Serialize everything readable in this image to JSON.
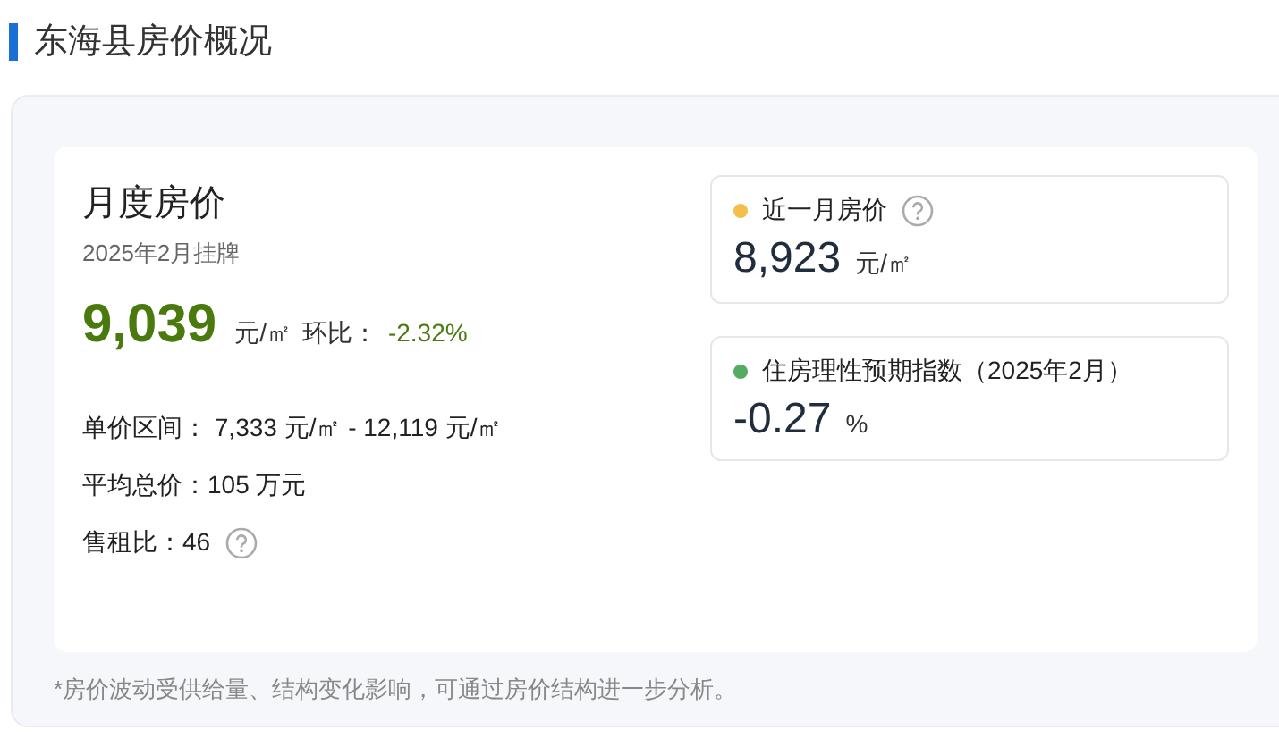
{
  "title": "东海县房价概况",
  "monthly": {
    "title": "月度房价",
    "subtitle": "2025年2月挂牌",
    "price": "9,039",
    "unit": "元/㎡",
    "change_label": "环比：",
    "change": "-2.32%",
    "details": [
      {
        "text": "单价区间： 7,333 元/㎡ - 12,119 元/㎡",
        "help": false
      },
      {
        "text": "平均总价：105 万元",
        "help": false
      },
      {
        "text": "售租比：46",
        "help": true
      }
    ]
  },
  "indicators": [
    {
      "label": "近一月房价",
      "color": "#f5bd4a",
      "help": true,
      "value": "8,923",
      "unit": "元/㎡"
    },
    {
      "label": "住房理性预期指数（2025年2月）",
      "color": "#52ad5e",
      "help": false,
      "value": "-0.27",
      "unit": "%"
    }
  ],
  "footnote": "*房价波动受供给量、结构变化影响，可通过房价结构进一步分析。"
}
